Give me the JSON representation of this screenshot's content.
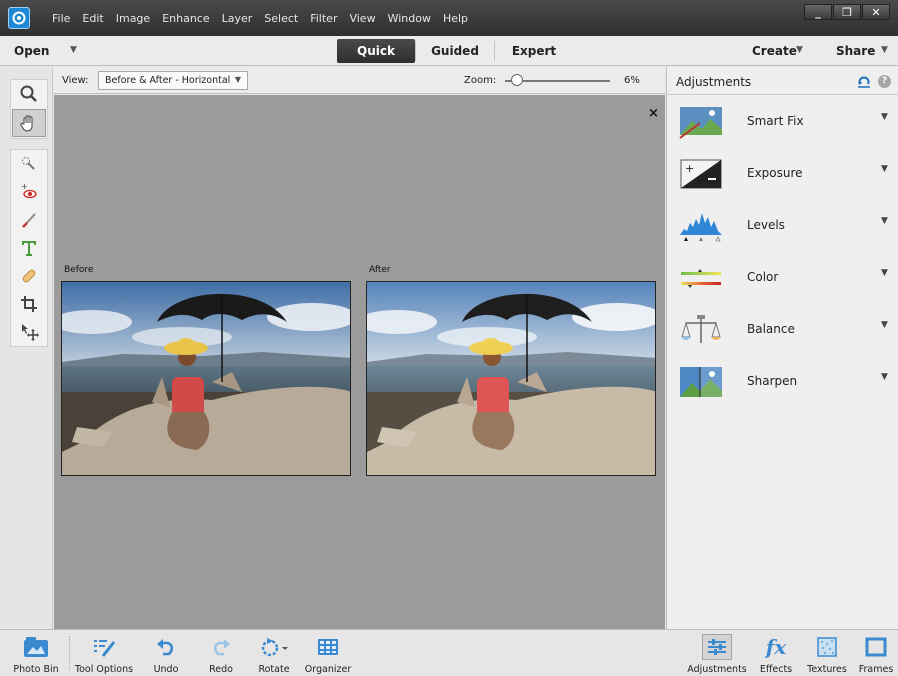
{
  "menubar": {
    "items": [
      "File",
      "Edit",
      "Image",
      "Enhance",
      "Layer",
      "Select",
      "Filter",
      "View",
      "Window",
      "Help"
    ],
    "window_controls": [
      "minimize-icon",
      "restore-icon",
      "close-icon"
    ],
    "window_glyphs": [
      "_",
      "❐",
      "✕"
    ]
  },
  "modebar": {
    "open_label": "Open",
    "tabs": [
      "Quick",
      "Guided",
      "Expert"
    ],
    "active_tab": "Quick",
    "create_label": "Create",
    "share_label": "Share",
    "caret": "▼"
  },
  "options": {
    "view_label": "View:",
    "view_value": "Before & After - Horizontal",
    "zoom_label": "Zoom:",
    "zoom_value": "6%",
    "zoom_fraction": 0.06
  },
  "canvas": {
    "close_glyph": "×",
    "before_label": "Before",
    "after_label": "After",
    "background_color": "#9b9b9b"
  },
  "panel": {
    "title": "Adjustments",
    "items": [
      {
        "label": "Smart Fix",
        "icon": "smart-fix-icon"
      },
      {
        "label": "Exposure",
        "icon": "exposure-icon"
      },
      {
        "label": "Levels",
        "icon": "levels-icon"
      },
      {
        "label": "Color",
        "icon": "color-icon"
      },
      {
        "label": "Balance",
        "icon": "balance-icon"
      },
      {
        "label": "Sharpen",
        "icon": "sharpen-icon"
      }
    ]
  },
  "tools": [
    "zoom-icon",
    "hand-icon",
    "quick-selection-icon",
    "red-eye-icon",
    "whiten-teeth-icon",
    "type-icon",
    "spot-healing-icon",
    "crop-icon",
    "move-icon"
  ],
  "taskbar": {
    "left": [
      "Photo Bin",
      "Tool Options",
      "Undo",
      "Redo",
      "Rotate",
      "Organizer"
    ],
    "right": [
      "Adjustments",
      "Effects",
      "Textures",
      "Frames"
    ]
  },
  "colors": {
    "accent": "#1e88d4",
    "active_tab_bg": "#3a3a3a",
    "menubar_bg": "#3d3d3d"
  }
}
